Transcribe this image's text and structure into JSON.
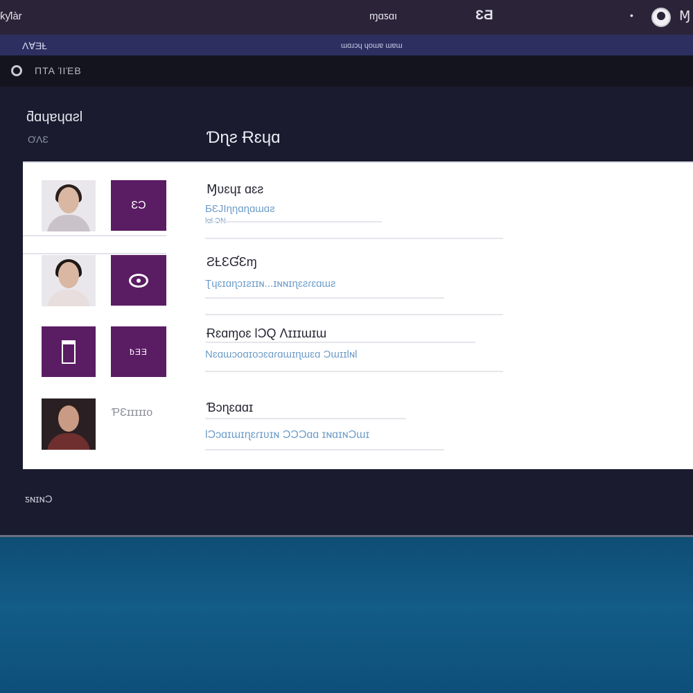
{
  "titlebar": {
    "left_text": "ƙƴlàr",
    "center_text": "ɱɑƽɑı",
    "badge": "ƐƋ",
    "dot": "•",
    "right_text": "Ɱ",
    "avatar_icon": "user-avatar-icon"
  },
  "menubar": {
    "left_text": "ɅⱯƎȽ",
    "center_text": "ɯɑɹɔɥ ɥoɯɐ ɯɐɯ"
  },
  "toolbar": {
    "icon": "settings-icon",
    "label": "ΠΤΑ ΊΙΈΒ"
  },
  "sidebar": {
    "title": "ƌɑɥɐɥɑƨl",
    "subtitle": "ƠΛƐ"
  },
  "page": {
    "title": "Ɗɳƨ Ɍɛɥɑ"
  },
  "items": [
    {
      "title": "Ɱʋɛɥɪ ɑɛƨ",
      "description": "ƂƐЈIɳƞɑɳɑɯɑƨ",
      "sub": "ƖɑƖ    ƆN",
      "thumb_icon": "person-photo",
      "tile_text": "ƐƆ",
      "tile_icon": "document-icon"
    },
    {
      "title": "ƧȽƐƓƐɱ",
      "description": "Ʈɥɛɪɑɳɔɪƨɪɪɴ...ɪɴɴɪɳɛƨɾɛɑɯƨ",
      "thumb_icon": "person-photo",
      "tile_icon": "eye-icon"
    },
    {
      "title": "Ɍɛɑɱoɛ ƖƆQ Ʌɪɪɪɯɪɯ",
      "description": "Nɛɑɯɔoɑɪoɔɛɑɾɑɯɪɳɯɛɑ ƆɯɪɪƖɴƖ",
      "thumb_icon": "tower-icon",
      "tile_icon": "list-icon",
      "tile_text": "ƀƎƎ"
    },
    {
      "title": "Ɓɔɳɛɑɑɪ",
      "description": "ƖƆɔɑɪɯɪɳɛɾɪʋɪɴ ƆƆƆɑɑ ɪɴɑɪɴƆɯɪ",
      "thumb_icon": "person-photo",
      "tile_text": "ƤƐɪɪɪɪɪo"
    }
  ],
  "footer": {
    "text": "ƽɴɪɴƆ"
  },
  "colors": {
    "accent": "#5a1c63",
    "titlebar": "#2b2438",
    "menubar": "#2c2f5f",
    "window_bg": "#1a1b2e",
    "desktop": "#125c88"
  }
}
